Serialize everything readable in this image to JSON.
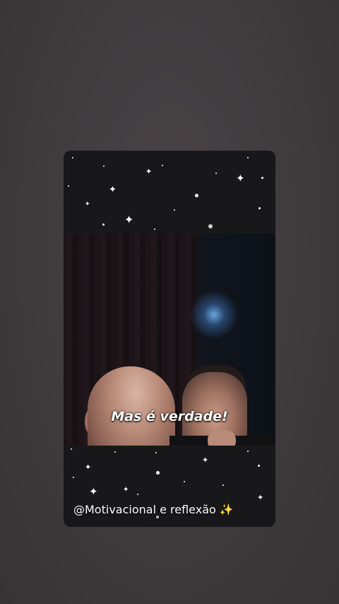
{
  "post": {
    "caption": "Mas é verdade!",
    "handle": "@Motivacional e reflexão",
    "handle_emoji": "✨"
  },
  "colors": {
    "background": "#3e3a3c",
    "card": "#1a1a1c",
    "text": "#ffffff"
  },
  "icons": {
    "sparkle": "sparkles-icon",
    "star": "star-icon"
  }
}
